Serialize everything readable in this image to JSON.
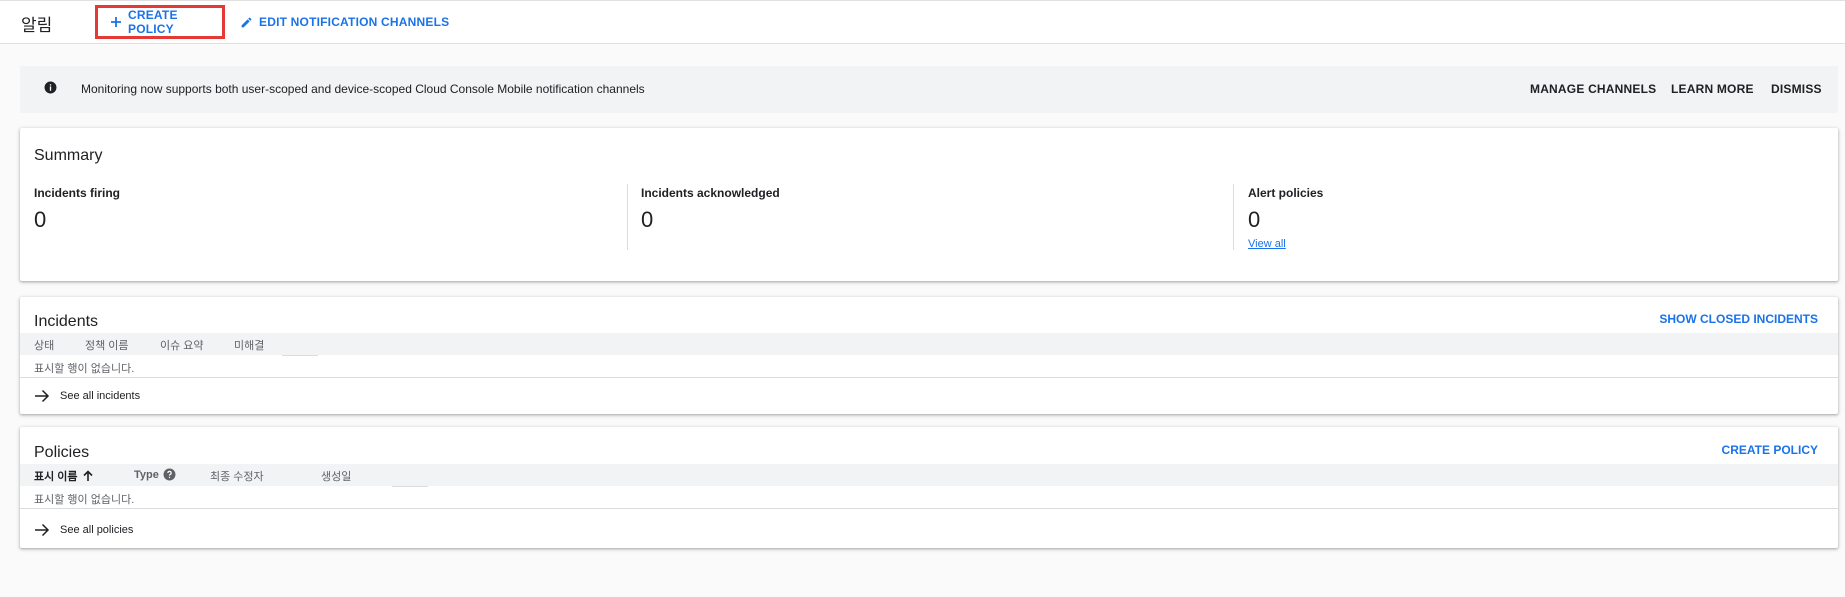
{
  "header": {
    "title": "알림",
    "create_policy_label": "CREATE POLICY",
    "edit_channels_label": "EDIT NOTIFICATION CHANNELS"
  },
  "banner": {
    "icon": "info-icon",
    "text": "Monitoring now supports both user-scoped and device-scoped Cloud Console Mobile notification channels",
    "actions": [
      "MANAGE CHANNELS",
      "LEARN MORE",
      "DISMISS"
    ]
  },
  "summary": {
    "title": "Summary",
    "stats": [
      {
        "label": "Incidents firing",
        "value": "0"
      },
      {
        "label": "Incidents acknowledged",
        "value": "0"
      },
      {
        "label": "Alert policies",
        "value": "0",
        "link": "View all"
      }
    ]
  },
  "incidents": {
    "title": "Incidents",
    "action": "SHOW CLOSED INCIDENTS",
    "columns": [
      "상태",
      "정책 이름",
      "이슈 요약",
      "미해결"
    ],
    "empty_text": "표시할 행이 없습니다.",
    "see_all": "See all incidents"
  },
  "policies": {
    "title": "Policies",
    "action": "CREATE POLICY",
    "columns": [
      "표시 이름",
      "Type",
      "최종 수정자",
      "생성일"
    ],
    "sorted_column": "표시 이름",
    "sort_direction": "ascending",
    "empty_text": "표시할 행이 없습니다.",
    "see_all": "See all policies"
  },
  "colors": {
    "accent": "#1a73e8",
    "highlight_border": "#e53935",
    "banner_bg": "#f1f3f4"
  }
}
